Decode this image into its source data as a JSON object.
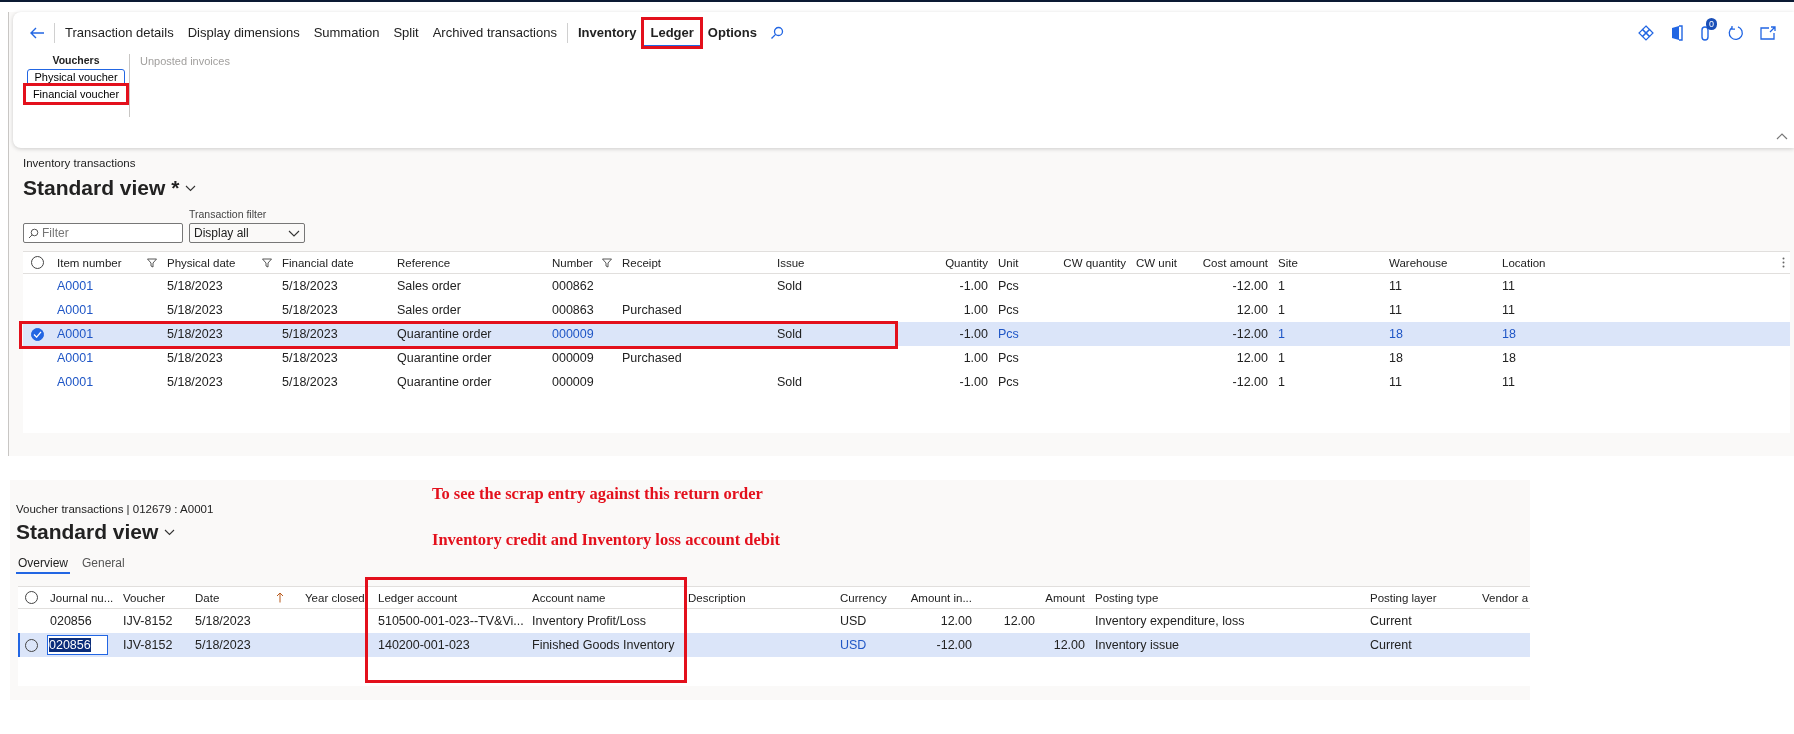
{
  "action_bar": {
    "items": [
      {
        "label": "Transaction details",
        "kind": "button",
        "selected": false,
        "highlighted": false
      },
      {
        "label": "Display dimensions",
        "kind": "button",
        "selected": false,
        "highlighted": false
      },
      {
        "label": "Summation",
        "kind": "button",
        "selected": false,
        "highlighted": false
      },
      {
        "label": "Split",
        "kind": "button",
        "selected": false,
        "highlighted": false
      },
      {
        "label": "Archived transactions",
        "kind": "button",
        "selected": false,
        "highlighted": false
      },
      {
        "label": "Inventory",
        "kind": "menu",
        "selected": false,
        "highlighted": false
      },
      {
        "label": "Ledger",
        "kind": "menu",
        "selected": true,
        "highlighted": true
      },
      {
        "label": "Options",
        "kind": "menu",
        "selected": false,
        "highlighted": false
      }
    ],
    "attachments_badge": "0"
  },
  "ribbon": {
    "group_title": "Vouchers",
    "buttons": [
      {
        "label": "Physical voucher",
        "focused": true,
        "highlighted": false
      },
      {
        "label": "Financial voucher",
        "focused": false,
        "highlighted": true
      }
    ],
    "other_items": [
      {
        "label": "Unposted invoices",
        "disabled": true
      }
    ]
  },
  "inventory": {
    "caption": "Inventory transactions",
    "view_name": "Standard view *",
    "filter": {
      "placeholder": "Filter"
    },
    "transaction_filter": {
      "label": "Transaction filter",
      "value": "Display all"
    },
    "select_all": {
      "checked": false
    },
    "columns": [
      {
        "label": "Item number",
        "kind": "link",
        "filtered": true
      },
      {
        "label": "Physical date",
        "kind": "text",
        "filtered": true
      },
      {
        "label": "Financial date",
        "kind": "text",
        "filtered": false
      },
      {
        "label": "Reference",
        "kind": "text",
        "filtered": false
      },
      {
        "label": "Number",
        "kind": "lookup",
        "filtered": true
      },
      {
        "label": "Receipt",
        "kind": "text",
        "filtered": false
      },
      {
        "label": "Issue",
        "kind": "text",
        "filtered": false
      },
      {
        "label": "Quantity",
        "kind": "number",
        "filtered": false
      },
      {
        "label": "Unit",
        "kind": "lookup",
        "filtered": false
      },
      {
        "label": "CW quantity",
        "kind": "number",
        "filtered": false
      },
      {
        "label": "CW unit",
        "kind": "text",
        "filtered": false
      },
      {
        "label": "Cost amount",
        "kind": "number",
        "filtered": false
      },
      {
        "label": "Site",
        "kind": "lookup",
        "filtered": false
      },
      {
        "label": "Warehouse",
        "kind": "lookup",
        "filtered": false
      },
      {
        "label": "Location",
        "kind": "lookup",
        "filtered": false
      }
    ],
    "rows": [
      {
        "selected": false,
        "checked": false,
        "highlighted": false,
        "cells": [
          "A0001",
          "5/18/2023",
          "5/18/2023",
          "Sales order",
          "000862",
          null,
          "Sold",
          "-1.00",
          "Pcs",
          null,
          null,
          "-12.00",
          "1",
          "11",
          "11"
        ]
      },
      {
        "selected": false,
        "checked": false,
        "highlighted": false,
        "cells": [
          "A0001",
          "5/18/2023",
          "5/18/2023",
          "Sales order",
          "000863",
          "Purchased",
          null,
          "1.00",
          "Pcs",
          null,
          null,
          "12.00",
          "1",
          "11",
          "11"
        ]
      },
      {
        "selected": true,
        "checked": true,
        "highlighted": true,
        "cells": [
          "A0001",
          "5/18/2023",
          "5/18/2023",
          "Quarantine order",
          "000009",
          null,
          "Sold",
          "-1.00",
          "Pcs",
          null,
          null,
          "-12.00",
          "1",
          "18",
          "18"
        ]
      },
      {
        "selected": false,
        "checked": false,
        "highlighted": false,
        "cells": [
          "A0001",
          "5/18/2023",
          "5/18/2023",
          "Quarantine order",
          "000009",
          "Purchased",
          null,
          "1.00",
          "Pcs",
          null,
          null,
          "12.00",
          "1",
          "18",
          "18"
        ]
      },
      {
        "selected": false,
        "checked": false,
        "highlighted": false,
        "cells": [
          "A0001",
          "5/18/2023",
          "5/18/2023",
          "Quarantine order",
          "000009",
          null,
          "Sold",
          "-1.00",
          "Pcs",
          null,
          null,
          "-12.00",
          "1",
          "11",
          "11"
        ]
      }
    ]
  },
  "annotations": [
    "To see the scrap entry against this return order",
    "Inventory credit and Inventory loss account debit"
  ],
  "vouchers": {
    "caption": "Voucher transactions  |  012679 : A0001",
    "view_name": "Standard view",
    "tabs": [
      {
        "label": "Overview",
        "selected": true
      },
      {
        "label": "General",
        "selected": false
      }
    ],
    "select_all": {
      "checked": false
    },
    "columns": [
      {
        "label": "Journal nu...",
        "kind": "editable",
        "sorted": false,
        "highlighted": false
      },
      {
        "label": "Voucher",
        "kind": "text",
        "sorted": false,
        "highlighted": false
      },
      {
        "label": "Date",
        "kind": "text",
        "sorted": true,
        "highlighted": false
      },
      {
        "label": "Year closed",
        "kind": "text",
        "sorted": false,
        "highlighted": false
      },
      {
        "label": "Ledger account",
        "kind": "text",
        "sorted": false,
        "highlighted": true
      },
      {
        "label": "Account name",
        "kind": "text",
        "sorted": false,
        "highlighted": true
      },
      {
        "label": "Description",
        "kind": "text",
        "sorted": false,
        "highlighted": false
      },
      {
        "label": "Currency",
        "kind": "lookup",
        "sorted": false,
        "highlighted": false
      },
      {
        "label": "Amount in...",
        "kind": "number",
        "sorted": false,
        "highlighted": false
      },
      {
        "kind": "number"
      },
      {
        "label": "Amount",
        "kind": "number",
        "sorted": false,
        "highlighted": false
      },
      {
        "label": "Posting type",
        "kind": "text",
        "sorted": false,
        "highlighted": false
      },
      {
        "label": "Posting layer",
        "kind": "text",
        "sorted": false,
        "highlighted": false
      },
      {
        "label": "Vendor a",
        "kind": "text",
        "sorted": false,
        "highlighted": false
      }
    ],
    "rows": [
      {
        "selected": false,
        "checked": false,
        "cells": [
          "020856",
          "IJV-8152",
          "5/18/2023",
          null,
          "510500-001-023--TV&Vi...",
          "Inventory Profit/Loss",
          null,
          "USD",
          "12.00",
          "12.00",
          null,
          "Inventory expenditure, loss",
          "Current",
          null
        ]
      },
      {
        "selected": true,
        "checked": false,
        "cells": [
          "020856",
          "IJV-8152",
          "5/18/2023",
          null,
          "140200-001-023",
          "Finished Goods Inventory",
          null,
          "USD",
          "-12.00",
          null,
          "12.00",
          "Inventory issue",
          "Current",
          null
        ]
      }
    ]
  }
}
